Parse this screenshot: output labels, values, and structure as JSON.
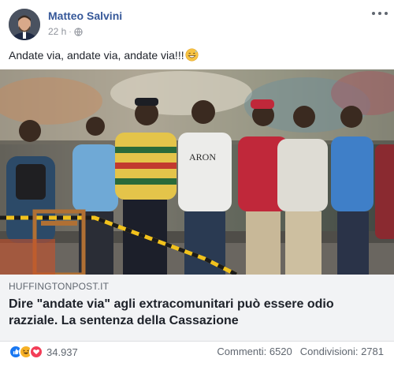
{
  "post": {
    "author": "Matteo Salvini",
    "time": "22 h",
    "separator": "·",
    "privacy_icon": "globe-icon",
    "message": "Andate via, andate via, andate via!!!",
    "message_emoji": "grinning-sweat-emoji"
  },
  "link": {
    "domain": "HUFFINGTONPOST.IT",
    "title": "Dire \"andate via\" agli extracomunitari può essere odio razziale. La sentenza della Cassazione",
    "photo_caption_shirt": "ARON"
  },
  "footer": {
    "reaction_icons": [
      "like-icon",
      "haha-icon",
      "love-icon"
    ],
    "reaction_count": "34.937",
    "comments": "Commenti: 6520",
    "shares": "Condivisioni: 2781"
  },
  "colors": {
    "author_link": "#365899",
    "meta_gray": "#90949c",
    "link_bg": "#f2f3f5",
    "like_blue": "#1877f2",
    "haha_yellow": "#f7b125",
    "love_red": "#f33e58"
  }
}
